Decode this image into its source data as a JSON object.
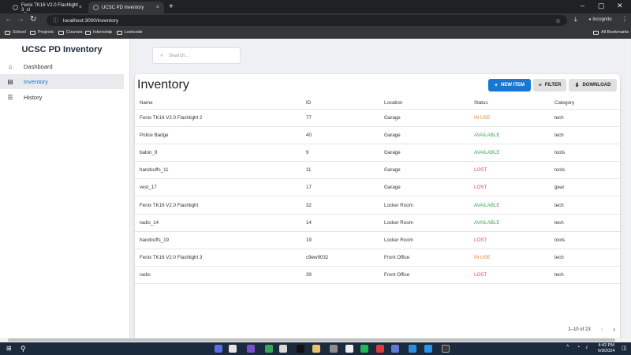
{
  "browser": {
    "tabs": [
      {
        "label": "Fenix TK16 V2.0 Flashlight 3_cl"
      },
      {
        "label": "UCSC PD Inventory"
      }
    ],
    "address": "localhost:3000/inventory",
    "incognito_label": "Incognito",
    "bookmarks": [
      "School",
      "Projects",
      "Courses",
      "Internship",
      "Leetcode"
    ],
    "all_bookmarks": "All Bookmarks"
  },
  "sidebar": {
    "brand": "UCSC PD Inventory",
    "items": [
      {
        "label": "Dashboard",
        "icon": "home-icon",
        "active": false
      },
      {
        "label": "Inventory",
        "icon": "inventory-icon",
        "active": true
      },
      {
        "label": "History",
        "icon": "history-list-icon",
        "active": false
      }
    ]
  },
  "search": {
    "placeholder": "Search..."
  },
  "main": {
    "title": "Inventory",
    "new_item_label": "NEW ITEM",
    "filter_label": "FILTER",
    "download_label": "DOWNLOAD",
    "accent_color": "#1976d2"
  },
  "table": {
    "columns": [
      "Name",
      "ID",
      "Location",
      "Status",
      "Category"
    ],
    "rows": [
      {
        "name": "Fenix TK16 V2.0 Flashlight 2",
        "id": "77",
        "location": "Garage",
        "status": "IN USE",
        "category": "tech"
      },
      {
        "name": "Police Badge",
        "id": "40",
        "location": "Garage",
        "status": "AVAILABLE",
        "category": "tech"
      },
      {
        "name": "baton_9",
        "id": "9",
        "location": "Garage",
        "status": "AVAILABLE",
        "category": "tools"
      },
      {
        "name": "handcuffs_11",
        "id": "11",
        "location": "Garage",
        "status": "LOST",
        "category": "tools"
      },
      {
        "name": "vest_17",
        "id": "17",
        "location": "Garage",
        "status": "LOST",
        "category": "gear"
      },
      {
        "name": "Fenix TK16 V2.0 Flashlight",
        "id": "32",
        "location": "Locker Room",
        "status": "AVAILABLE",
        "category": "tech"
      },
      {
        "name": "radio_14",
        "id": "14",
        "location": "Locker Room",
        "status": "AVAILABLE",
        "category": "tech"
      },
      {
        "name": "handcuffs_19",
        "id": "19",
        "location": "Locker Room",
        "status": "LOST",
        "category": "tools"
      },
      {
        "name": "Fenix TK16 V2.0 Flashlight 3",
        "id": "c9ew9032",
        "location": "Front Office",
        "status": "IN USE",
        "category": "tech"
      },
      {
        "name": "radio",
        "id": "39",
        "location": "Front Office",
        "status": "LOST",
        "category": "tech"
      }
    ],
    "status_colors": {
      "IN USE": "#e0873a",
      "AVAILABLE": "#3aa657",
      "LOST": "#e5484d"
    },
    "pagination": "1–10 of 23"
  },
  "taskbar": {
    "time": "4:42 PM",
    "date": "6/9/2024"
  }
}
